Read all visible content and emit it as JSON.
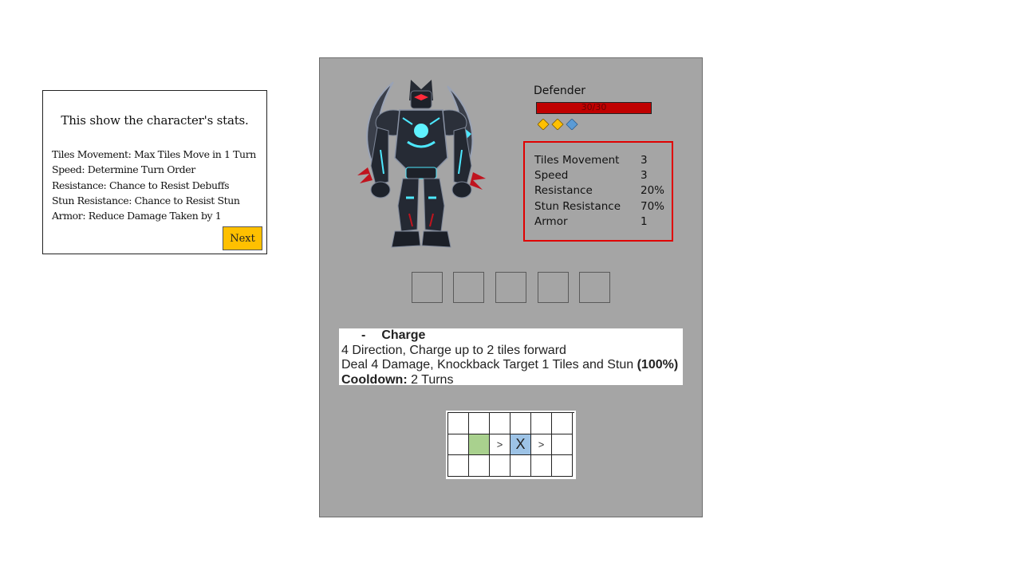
{
  "info": {
    "title": "This show the character's stats.",
    "lines": [
      "Tiles Movement: Max Tiles Move in 1 Turn",
      "Speed: Determine Turn Order",
      "Resistance:  Chance to Resist  Debuffs",
      "Stun Resistance:  Chance to Resist  Stun",
      "Armor: Reduce Damage Taken by 1"
    ],
    "next_label": "Next"
  },
  "character": {
    "name": "Defender",
    "hp_text": "30/30",
    "hp_fraction": 1.0,
    "diamonds": [
      {
        "color": "#ffc000",
        "icon": "gold-diamond-icon"
      },
      {
        "color": "#ffc000",
        "icon": "gold-diamond-icon"
      },
      {
        "color": "#5b9bd5",
        "icon": "blue-diamond-icon"
      }
    ],
    "stats": [
      {
        "label": "Tiles Movement",
        "value": "3"
      },
      {
        "label": "Speed",
        "value": "3"
      },
      {
        "label": "Resistance",
        "value": "20%"
      },
      {
        "label": "Stun Resistance",
        "value": "70%"
      },
      {
        "label": "Armor",
        "value": "1"
      }
    ],
    "slot_count": 5
  },
  "skill": {
    "bullet": "-",
    "name": "Charge",
    "line1": "4 Direction, Charge up to 2 tiles forward",
    "line2_text": "Deal 4 Damage, Knockback Target 1 Tiles and Stun ",
    "line2_bold": "(100%)",
    "cooldown_label": "Cooldown:",
    "cooldown_value": " 2 Turns"
  },
  "range_grid": {
    "rows": [
      [
        "",
        "",
        "",
        "",
        "",
        ""
      ],
      [
        "",
        "",
        ">",
        "X",
        ">",
        ""
      ],
      [
        "",
        "",
        "",
        "",
        "",
        ""
      ]
    ],
    "origin_color": "#a9d18e",
    "target_color": "#9dc3e6"
  },
  "colors": {
    "panel_bg": "#a5a5a5",
    "hp_red": "#c00000",
    "stats_border": "#e00000",
    "next_button": "#ffc000"
  }
}
